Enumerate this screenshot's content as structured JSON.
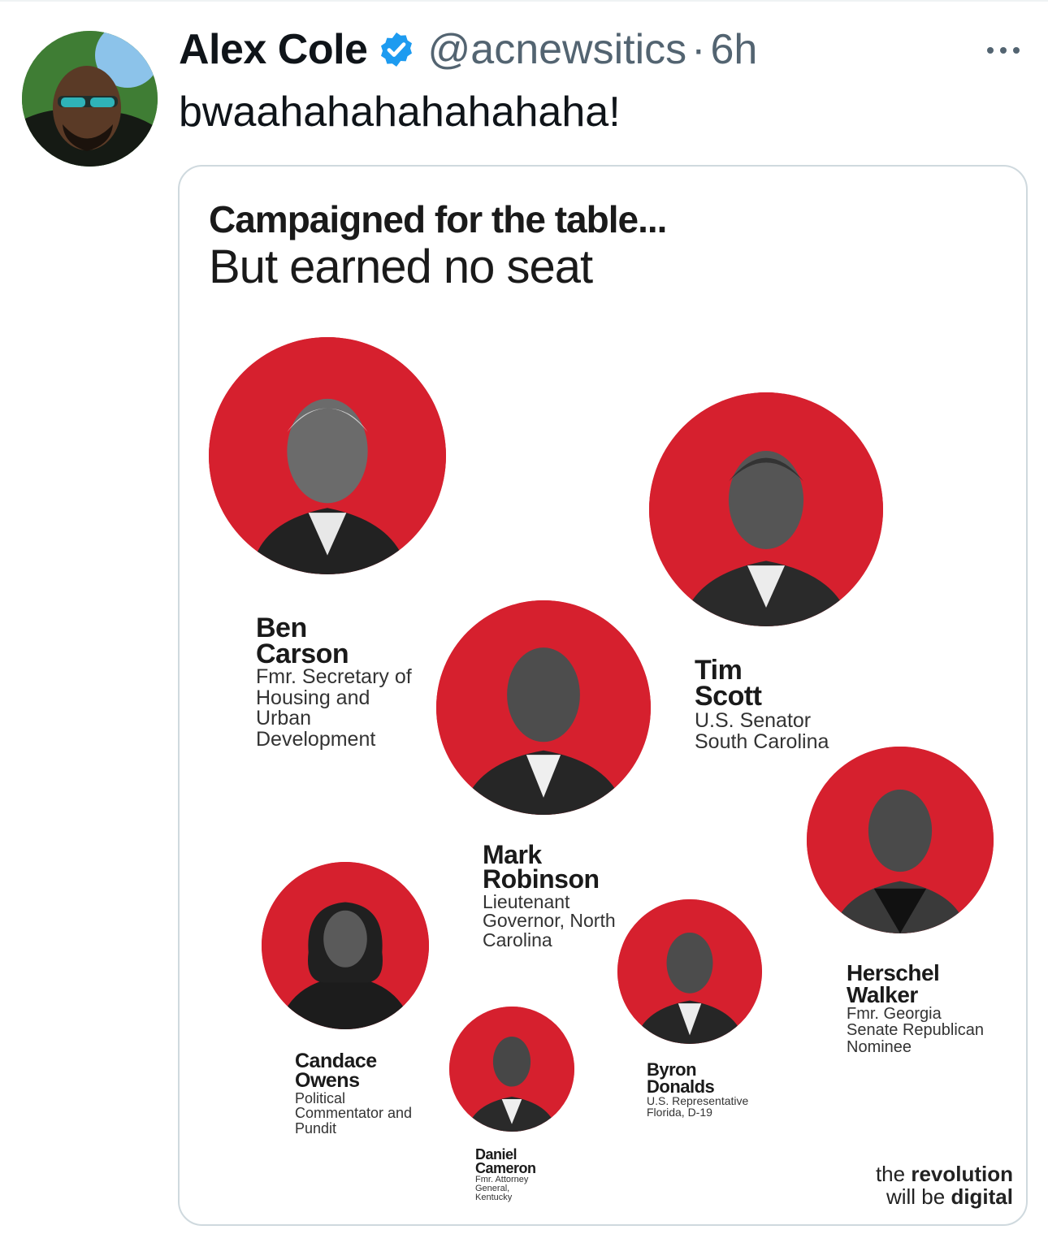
{
  "tweet": {
    "author_name": "Alex Cole",
    "handle": "@acnewsitics",
    "separator": "·",
    "time": "6h",
    "text": "bwaahahahahahahaha!",
    "verified_color": "#1d9bf0"
  },
  "graphic": {
    "title": "Campaigned for the table...",
    "subtitle": "But earned no seat",
    "accent_color": "#d6202e",
    "people": [
      {
        "name_line1": "Ben",
        "name_line2": "Carson",
        "role_lines": [
          "Fmr. Secretary of",
          "Housing and",
          "Urban",
          "Development"
        ]
      },
      {
        "name_line1": "Tim",
        "name_line2": "Scott",
        "role_lines": [
          "U.S. Senator",
          "South Carolina"
        ]
      },
      {
        "name_line1": "Mark",
        "name_line2": "Robinson",
        "role_lines": [
          "Lieutenant",
          "Governor, North",
          "Carolina"
        ]
      },
      {
        "name_line1": "Herschel",
        "name_line2": "Walker",
        "role_lines": [
          "Fmr. Georgia",
          "Senate Republican",
          "Nominee"
        ]
      },
      {
        "name_line1": "Candace",
        "name_line2": "Owens",
        "role_lines": [
          "Political",
          "Commentator and",
          "Pundit"
        ]
      },
      {
        "name_line1": "Byron",
        "name_line2": "Donalds",
        "role_lines": [
          "U.S. Representative",
          "Florida, D-19"
        ]
      },
      {
        "name_line1": "Daniel",
        "name_line2": "Cameron",
        "role_lines": [
          "Fmr. Attorney",
          "General,",
          "Kentucky"
        ]
      }
    ],
    "brand": {
      "line1_normal": "the ",
      "line1_bold": "revolution",
      "line2_normal": "will be ",
      "line2_bold": "digital"
    }
  }
}
